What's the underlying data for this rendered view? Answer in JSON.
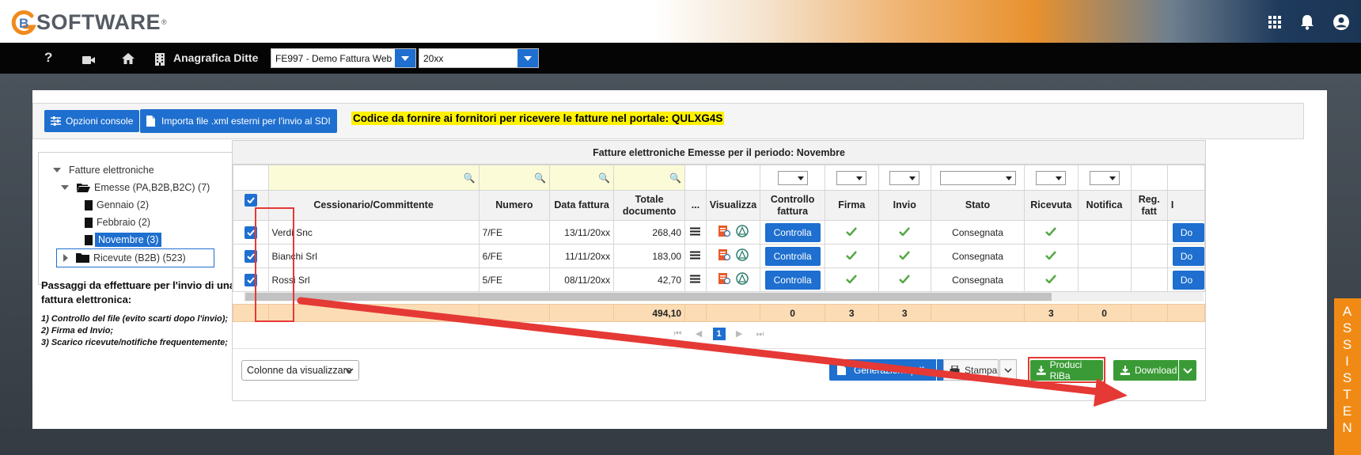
{
  "header": {
    "logo_text": "SOFTWARE",
    "logo_reg": "®",
    "icons": [
      "grid-apps-icon",
      "bell-icon",
      "user-icon"
    ]
  },
  "navbar": {
    "help_label": "?",
    "anagrafica_label": "Anagrafica Ditte",
    "company_select": "FE997 - Demo Fattura Web",
    "year_select": "20xx"
  },
  "toolbar": {
    "opzioni_label": "Opzioni console",
    "importa_label": "Importa file .xml esterni per l'invio al SDI",
    "codice_text": "Codice da fornire ai fornitori per ricevere le fatture nel portale: QULXG4S"
  },
  "tree": {
    "root": "Fatture elettroniche",
    "emesse": "Emesse (PA,B2B,B2C) (7)",
    "gennaio": "Gennaio (2)",
    "febbraio": "Febbraio (2)",
    "novembre": "Novembre (3)",
    "ricevute": "Ricevute (B2B) (523)"
  },
  "instructions": {
    "title": "Passaggi da effettuare per l'invio di una fattura elettronica:",
    "step1": "1) Controllo del file (evito scarti dopo l'invio);",
    "step2": "2) Firma ed Invio;",
    "step3": "3) Scarico ricevute/notifiche frequentemente;"
  },
  "grid": {
    "title": "Fatture elettroniche Emesse per il periodo: Novembre",
    "columns": {
      "cessionario": "Cessionario/Committente",
      "numero": "Numero",
      "data": "Data fattura",
      "totale": "Totale documento",
      "more": "...",
      "visualizza": "Visualizza",
      "controllo": "Controllo fattura",
      "firma": "Firma",
      "invio": "Invio",
      "stato": "Stato",
      "ricevuta": "Ricevuta",
      "notifica": "Notifica",
      "reg": "Reg. fatt",
      "cut": "I"
    },
    "rows": [
      {
        "cliente": "Verdi Snc",
        "numero": "7/FE",
        "data": "13/11/20xx",
        "totale": "268,40",
        "controlla": "Controlla",
        "stato": "Consegnata",
        "cut_btn": "Do"
      },
      {
        "cliente": "Bianchi Srl",
        "numero": "6/FE",
        "data": "11/11/20xx",
        "totale": "183,00",
        "controlla": "Controlla",
        "stato": "Consegnata",
        "cut_btn": "Do"
      },
      {
        "cliente": "Rossi Srl",
        "numero": "5/FE",
        "data": "08/11/20xx",
        "totale": "42,70",
        "controlla": "Controlla",
        "stato": "Consegnata",
        "cut_btn": "Do"
      }
    ],
    "totals": {
      "totale": "494,10",
      "controllo": "0",
      "firma": "3",
      "invio": "3",
      "ricevuta": "3",
      "notifica": "0"
    },
    "page": "1"
  },
  "bottom": {
    "colonne_label": "Colonne da visualizzare",
    "generazione_pdf": "Generazione pdf",
    "stampa": "Stampa",
    "produci_riba": "Produci RiBa",
    "download": "Download"
  },
  "assistenza": [
    "A",
    "S",
    "S",
    "I",
    "S",
    "T",
    "E",
    "N"
  ],
  "colors": {
    "primary_blue": "#1e6fcf",
    "green": "#3a9b36",
    "highlight_red": "#e53935",
    "assist_orange": "#f18a15",
    "total_row": "#fbdcb5",
    "codice_highlight": "#fff200"
  }
}
